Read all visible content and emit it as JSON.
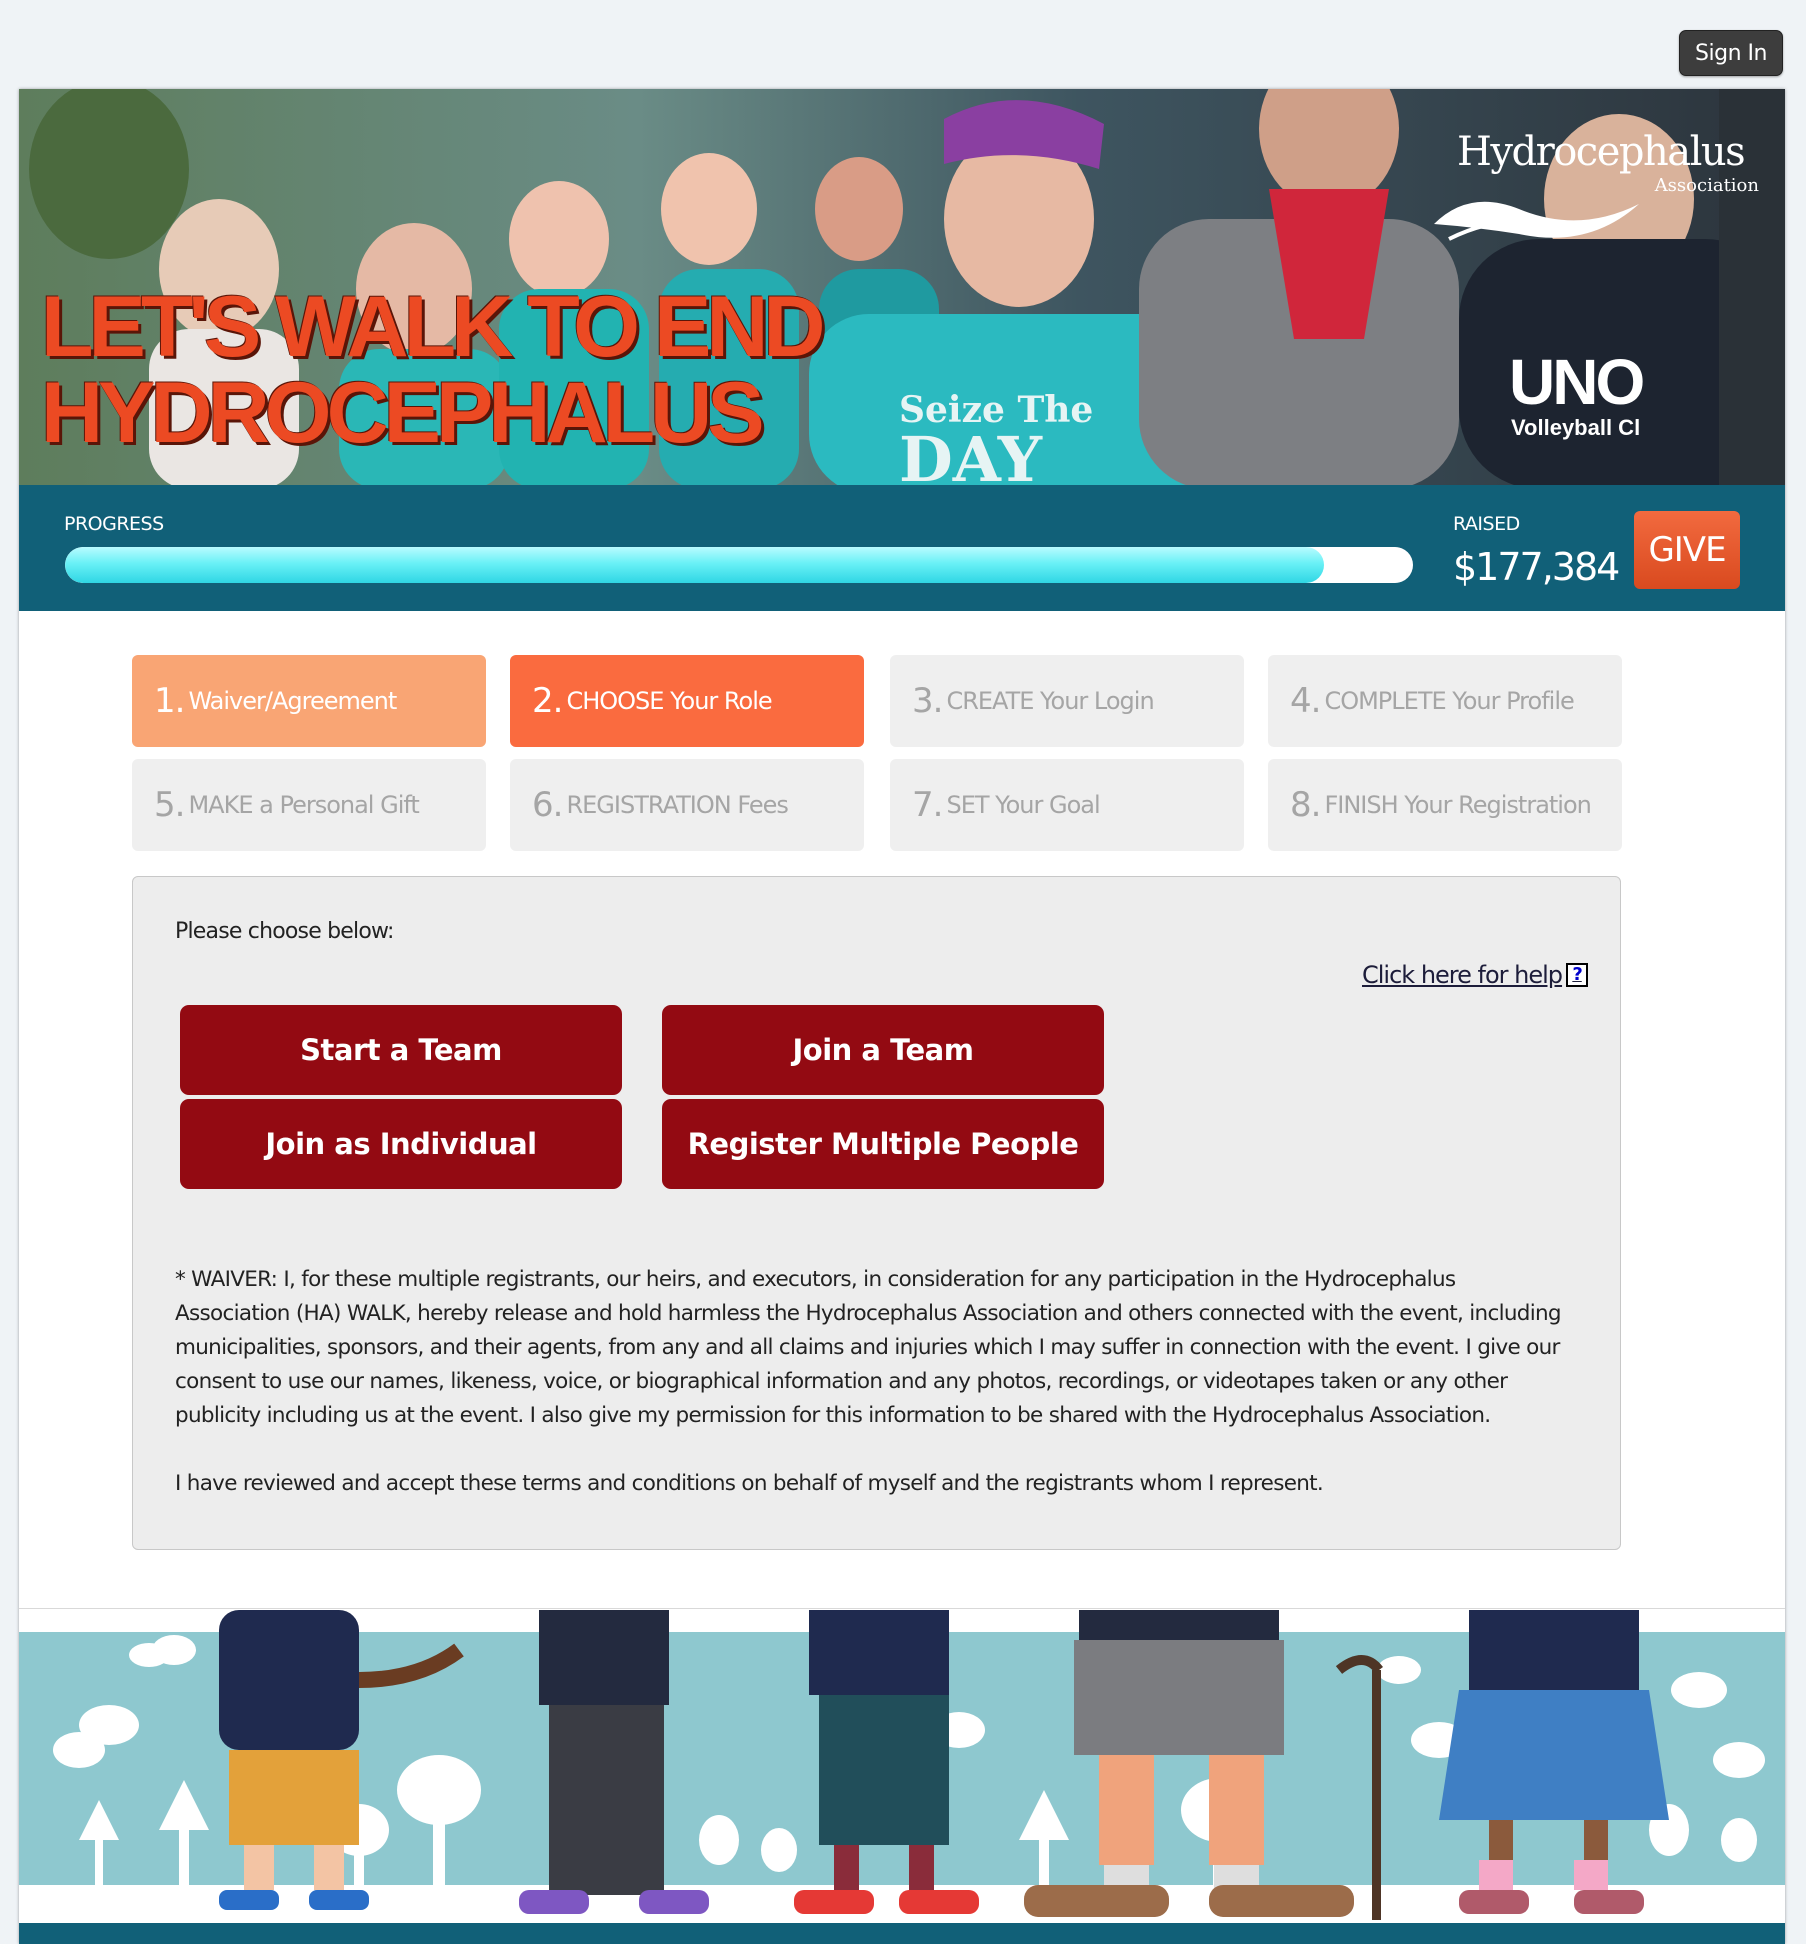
{
  "header": {
    "sign_in_label": "Sign In"
  },
  "banner": {
    "headline_line1": "LET'S WALK TO END",
    "headline_line2": "HYDROCEPHALUS",
    "logo_name": "Hydrocephalus",
    "logo_sub": "Association",
    "shirt_line1": "Seize The",
    "shirt_line2": "DAY",
    "jacket_text": "UNO",
    "jacket_sub": "Volleyball Cl"
  },
  "progress": {
    "label": "PROGRESS",
    "fraction": 0.934,
    "raised_label": "RAISED",
    "raised_value": "$177,384",
    "give_label": "GIVE"
  },
  "steps": [
    {
      "num": "1.",
      "label": "Waiver/Agreement",
      "state": "done"
    },
    {
      "num": "2.",
      "label": "CHOOSE Your Role",
      "state": "active"
    },
    {
      "num": "3.",
      "label": "CREATE Your Login",
      "state": "pending"
    },
    {
      "num": "4.",
      "label": "COMPLETE Your Profile",
      "state": "pending"
    },
    {
      "num": "5.",
      "label": "MAKE a Personal Gift",
      "state": "pending"
    },
    {
      "num": "6.",
      "label": "REGISTRATION Fees",
      "state": "pending"
    },
    {
      "num": "7.",
      "label": "SET Your Goal",
      "state": "pending"
    },
    {
      "num": "8.",
      "label": "FINISH Your Registration",
      "state": "pending"
    }
  ],
  "panel": {
    "choose_label": "Please choose below:",
    "help_label": "Click here for help",
    "help_icon": "?",
    "buttons": {
      "start_team": "Start a Team",
      "join_team": "Join a Team",
      "join_individual": "Join as Individual",
      "register_multiple": "Register Multiple People"
    },
    "waiver_text": "* WAIVER: I, for these multiple registrants, our heirs, and executors, in consideration for any participation in the Hydrocephalus Association (HA) WALK, hereby release and hold harmless the Hydrocephalus Association and others connected with the event, including municipalities, sponsors, and their agents, from any and all claims and injuries which I may suffer in connection with the event. I give our consent to use our names, likeness, voice, or biographical information and any photos, recordings, or videotapes taken or any other publicity including us at the event. I also give my permission for this information to be shared with the Hydrocephalus Association.",
    "accept_text": "I have reviewed and accept these terms and conditions on behalf of myself and the registrants whom I represent."
  },
  "colors": {
    "brand_teal": "#116078",
    "accent_orange": "#fa6b3f",
    "done_orange": "#f9a574",
    "button_red": "#930a12",
    "progress_fill": "#6af1f6"
  }
}
